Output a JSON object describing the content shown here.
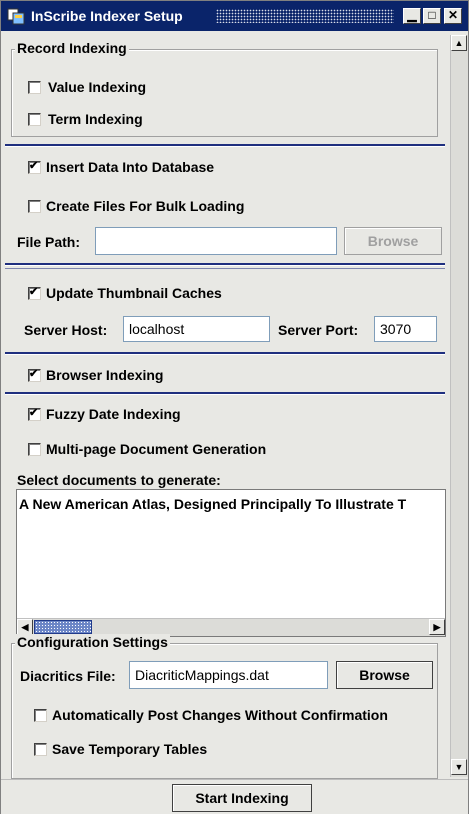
{
  "window": {
    "title": "InScribe Indexer Setup"
  },
  "record_indexing": {
    "legend": "Record Indexing",
    "value_indexing": {
      "label": "Value Indexing",
      "checked": false
    },
    "term_indexing": {
      "label": "Term Indexing",
      "checked": false
    }
  },
  "database": {
    "insert_data": {
      "label": "Insert Data Into Database",
      "checked": true
    },
    "bulk_loading": {
      "label": "Create Files For Bulk Loading",
      "checked": false
    },
    "file_path_label": "File Path:",
    "file_path_value": "",
    "browse_label": "Browse"
  },
  "thumbnails": {
    "update_caches": {
      "label": "Update Thumbnail Caches",
      "checked": true
    },
    "server_host_label": "Server Host:",
    "server_host_value": "localhost",
    "server_port_label": "Server Port:",
    "server_port_value": "3070"
  },
  "browser": {
    "browser_indexing": {
      "label": "Browser Indexing",
      "checked": true
    }
  },
  "documents": {
    "fuzzy_date": {
      "label": "Fuzzy Date Indexing",
      "checked": true
    },
    "multipage": {
      "label": "Multi-page Document Generation",
      "checked": false
    },
    "select_label": "Select documents to generate:",
    "items": [
      "A New American Atlas, Designed Principally To Illustrate T"
    ]
  },
  "config": {
    "legend": "Configuration Settings",
    "diacritics_label": "Diacritics File:",
    "diacritics_value": "DiacriticMappings.dat",
    "browse_label": "Browse",
    "auto_post": {
      "label": "Automatically Post Changes Without Confirmation",
      "checked": false
    },
    "save_temp": {
      "label": "Save Temporary Tables",
      "checked": false
    }
  },
  "footer": {
    "start_label": "Start Indexing"
  }
}
